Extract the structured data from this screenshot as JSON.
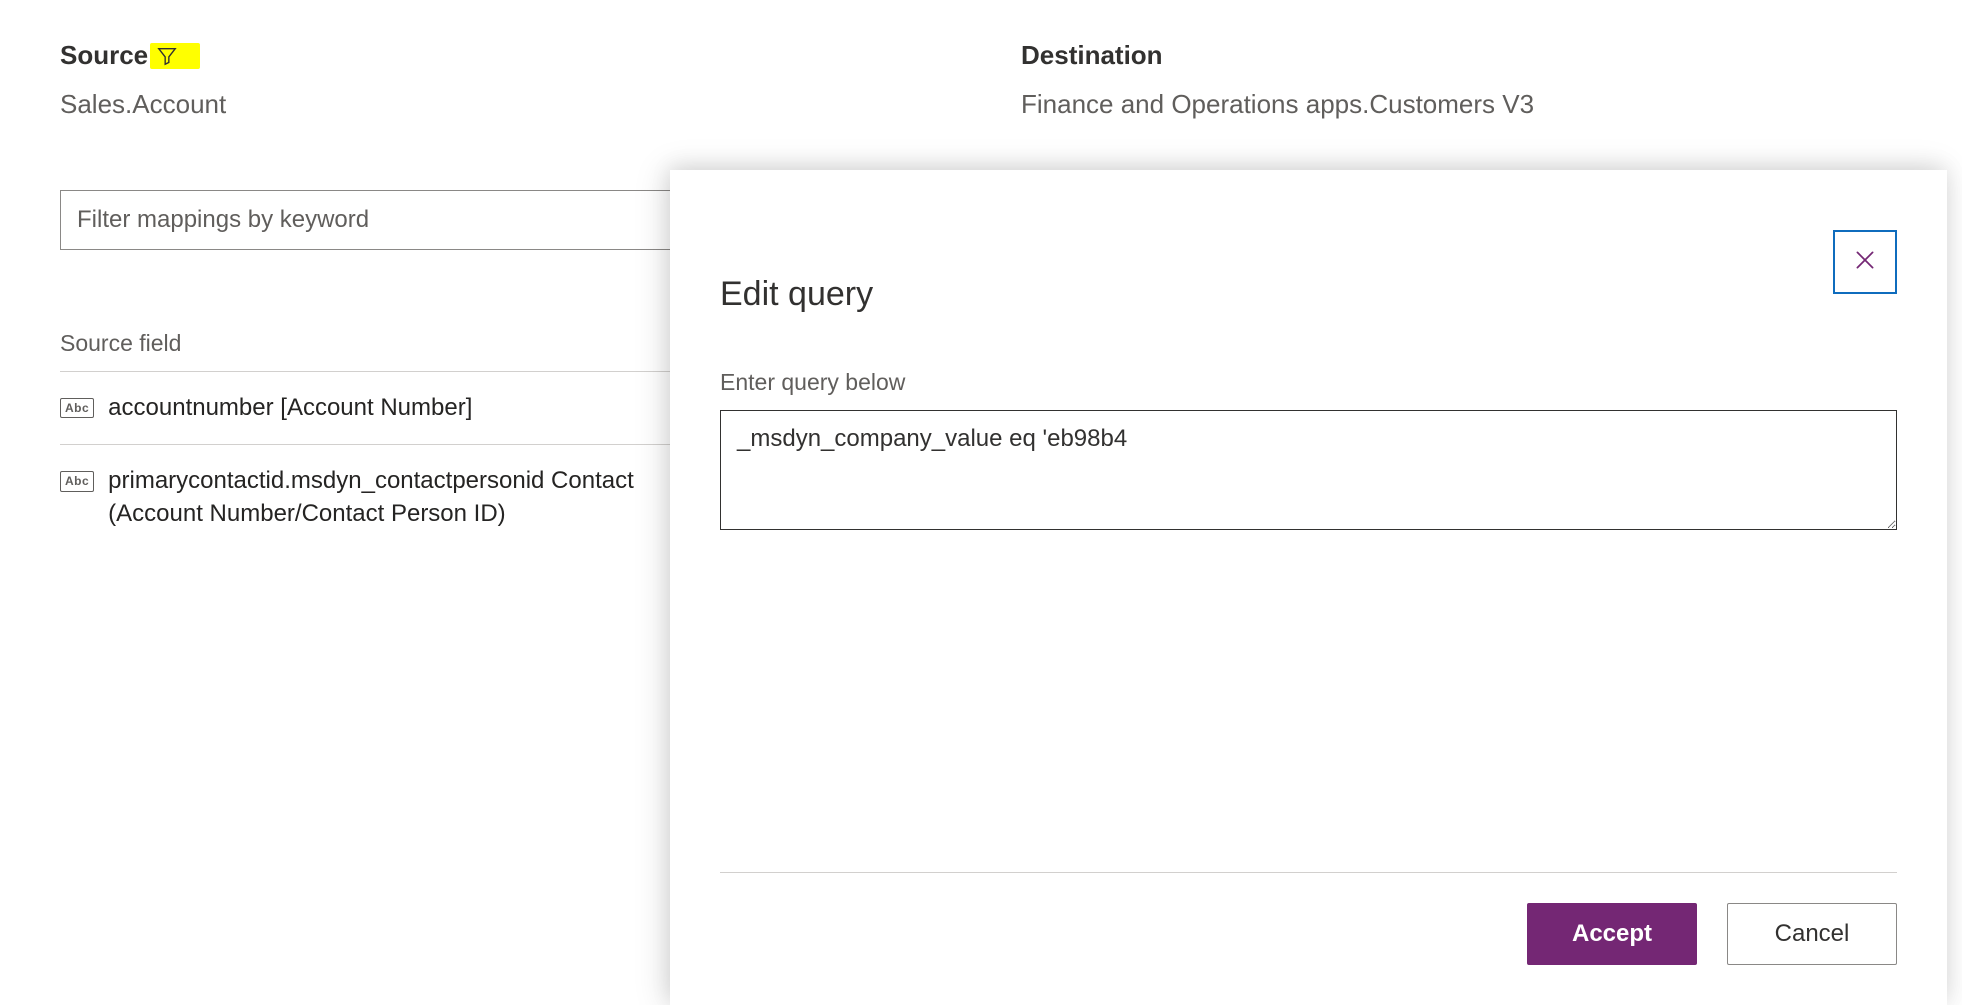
{
  "source": {
    "heading": "Source",
    "entity": "Sales.Account",
    "filter_icon_name": "filter-icon"
  },
  "destination": {
    "heading": "Destination",
    "entity": "Finance and Operations apps.Customers V3"
  },
  "filter": {
    "placeholder": "Filter mappings by keyword"
  },
  "columns": {
    "source_field": "Source field"
  },
  "rows": [
    {
      "badge": "Abc",
      "text": "accountnumber [Account Number]"
    },
    {
      "badge": "Abc",
      "text": "primarycontactid.msdyn_contactpersonid Contact (Account Number/Contact Person ID)"
    }
  ],
  "dialog": {
    "title": "Edit query",
    "label": "Enter query below",
    "query": "_msdyn_company_value eq 'eb98b4",
    "accept": "Accept",
    "cancel": "Cancel"
  }
}
